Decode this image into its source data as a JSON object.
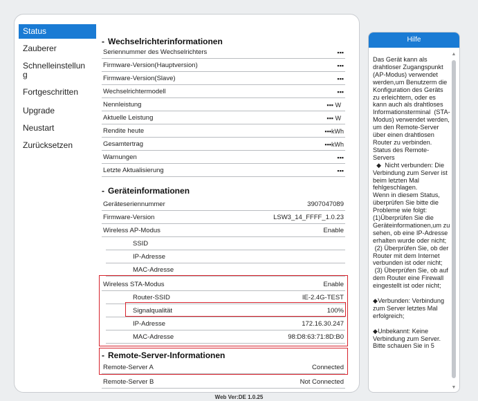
{
  "nav": {
    "items": [
      {
        "label": "Status"
      },
      {
        "label": "Zauberer"
      },
      {
        "label": "Schnelleinstellung"
      },
      {
        "label": "Fortgeschritten"
      },
      {
        "label": "Upgrade"
      },
      {
        "label": "Neustart"
      },
      {
        "label": "Zurücksetzen"
      }
    ]
  },
  "inverter": {
    "title": "Wechselrichterinformationen",
    "rows": [
      {
        "label": "Seriennummer des Wechselrichters",
        "value": "▪▪▪",
        "unit": ""
      },
      {
        "label": "Firmware-Version(Hauptversion)",
        "value": "▪▪▪",
        "unit": ""
      },
      {
        "label": "Firmware-Version(Slave)",
        "value": "▪▪▪",
        "unit": ""
      },
      {
        "label": "Wechselrichtermodell",
        "value": "▪▪▪",
        "unit": ""
      },
      {
        "label": "Nennleistung",
        "value": "▪▪▪",
        "unit": "W"
      },
      {
        "label": "Aktuelle Leistung",
        "value": "▪▪▪",
        "unit": "W"
      },
      {
        "label": "Rendite heute",
        "value": "▪▪▪",
        "unit": "kWh"
      },
      {
        "label": "Gesamtertrag",
        "value": "▪▪▪",
        "unit": "kWh"
      },
      {
        "label": "Warnungen",
        "value": "▪▪▪",
        "unit": ""
      },
      {
        "label": "Letzte Aktualisierung",
        "value": "▪▪▪",
        "unit": ""
      }
    ]
  },
  "device": {
    "title": "Geräteinformationen",
    "serial_label": "Geräteseriennummer",
    "serial_value": "3907047089",
    "fw_label": "Firmware-Version",
    "fw_value": "LSW3_14_FFFF_1.0.23",
    "ap_label": "Wireless AP-Modus",
    "ap_value": "Enable",
    "ap_ssid_label": "SSID",
    "ap_ip_label": "IP-Adresse",
    "ap_mac_label": "MAC-Adresse",
    "sta_label": "Wireless STA-Modus",
    "sta_value": "Enable",
    "router_ssid_label": "Router-SSID",
    "router_ssid_value": "IE-2.4G-TEST",
    "signal_label": "Signalqualität",
    "signal_value": "100%",
    "sta_ip_label": "IP-Adresse",
    "sta_ip_value": "172.16.30.247",
    "sta_mac_label": "MAC-Adresse",
    "sta_mac_value": "98:D8:63:71:8D:B0"
  },
  "remote": {
    "title": "Remote-Server-Informationen",
    "a_label": "Remote-Server A",
    "a_value": "Connected",
    "b_label": "Remote-Server B",
    "b_value": "Not Connected"
  },
  "footer": "Web Ver:DE 1.0.25",
  "help": {
    "title": "Hilfe",
    "text": "Das Gerät kann als drahtloser Zugangspunkt (AP-Modus) verwendet werden,um Benutzerm die Konfiguration des Geräts zu erleichtern, oder es kann auch als drahtloses Informationsterminal  (STA-Modus) verwendet werden, um den Remote-Server  über einen drahtlosen Router zu verbinden.\nStatus des Remote-Servers\n  ◆  Nicht verbunden: Die Verbindung zum Server ist beim letzten Mal fehlgeschlagen.\nWenn in diesem Status, überprüfen Sie bitte die Probleme wie folgt:\n(1)Überprüfen Sie die Geräteinformationen,um zu sehen, ob eine IP-Adresse erhalten wurde oder nicht;\n (2) Überprüfen Sie, ob der Router mit dem Internet verbunden ist oder nicht;\n (3) Überprüfen Sie, ob auf dem Router eine Firewall eingestellt ist oder nicht;\n\n◆Verbunden: Verbindung zum Server letztes Mal erfolgreich;\n\n◆Unbekannt: Keine Verbindung zum Server. Bitte schauen Sie in 5"
  }
}
